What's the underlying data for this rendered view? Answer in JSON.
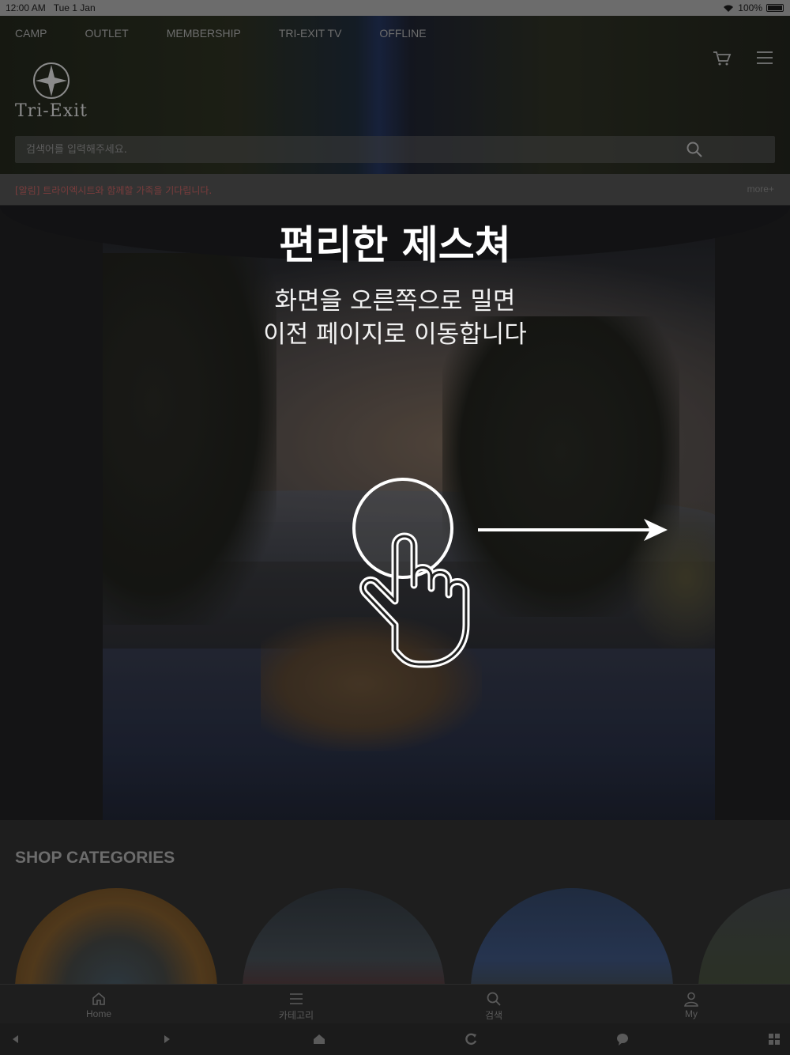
{
  "status_bar": {
    "time": "12:00 AM",
    "date": "Tue 1 Jan",
    "battery": "100%"
  },
  "header": {
    "nav": [
      "CAMP",
      "OUTLET",
      "MEMBERSHIP",
      "TRI-EXIT TV",
      "OFFLINE"
    ],
    "logo_text": "Tri-Exit",
    "search_placeholder": "검색어를 입력해주세요."
  },
  "notice": {
    "text": "[알림] 트라이엑시트와 함께할 가족을 기다립니다.",
    "more": "more+"
  },
  "gesture_overlay": {
    "title": "편리한 제스쳐",
    "line1": "화면을 오른쪽으로 밀면",
    "line2": "이전 페이지로 이동합니다"
  },
  "categories": {
    "title": "SHOP CATEGORIES"
  },
  "tabbar": {
    "items": [
      {
        "label": "Home",
        "icon": "home-icon"
      },
      {
        "label": "카테고리",
        "icon": "menu-icon"
      },
      {
        "label": "검색",
        "icon": "search-icon"
      },
      {
        "label": "My",
        "icon": "user-icon"
      }
    ]
  },
  "browser_bar": {
    "icons": [
      "back-icon",
      "forward-icon",
      "home-icon",
      "refresh-icon",
      "chat-icon",
      "grid-icon"
    ]
  },
  "colors": {
    "overlay_text": "#ffffff",
    "notice_text": "#7a3c3c",
    "inactive": "#5a5a5a"
  }
}
